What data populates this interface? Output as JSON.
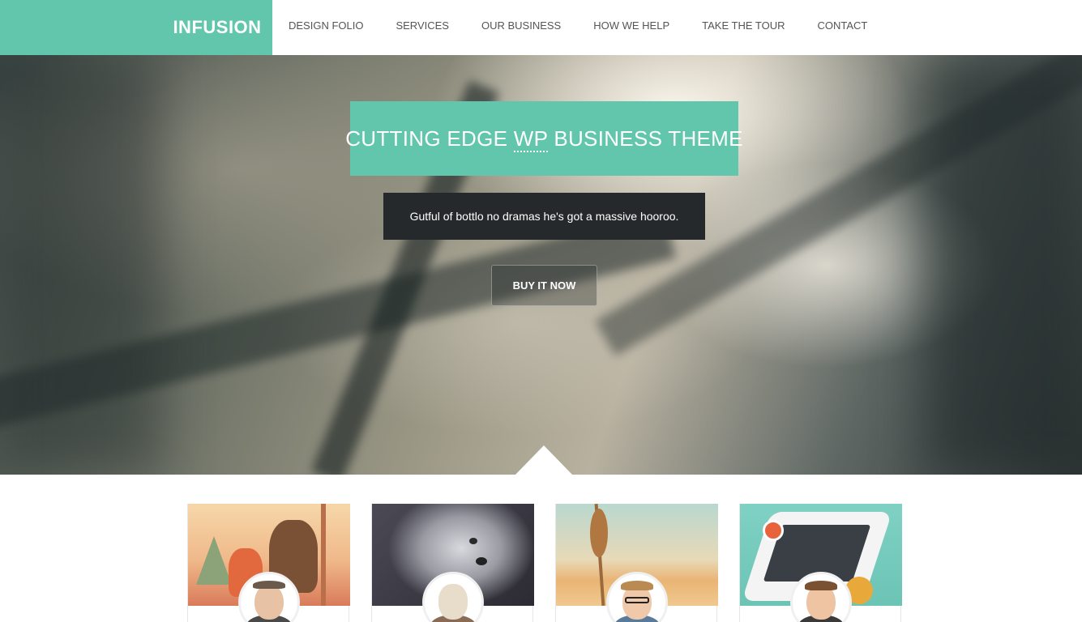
{
  "header": {
    "logo": "INFUSION",
    "nav": [
      "DESIGN FOLIO",
      "SERVICES",
      "OUR BUSINESS",
      "HOW WE HELP",
      "TAKE THE TOUR",
      "CONTACT"
    ]
  },
  "hero": {
    "title_before": "CUTTING EDGE ",
    "title_abbr": "WP",
    "title_after": " BUSINESS THEME",
    "subtitle": "Gutful of bottlo no dramas he's got a massive hooroo.",
    "button": "BUY IT NOW"
  },
  "team": {
    "cards": [
      {
        "image": "illustration-bears-in-forest"
      },
      {
        "image": "white-wolf-photo"
      },
      {
        "image": "wheat-field-photo"
      },
      {
        "image": "isometric-phone-illustration"
      }
    ]
  },
  "colors": {
    "accent": "#62c6ac",
    "dark_box": "#25292b"
  }
}
